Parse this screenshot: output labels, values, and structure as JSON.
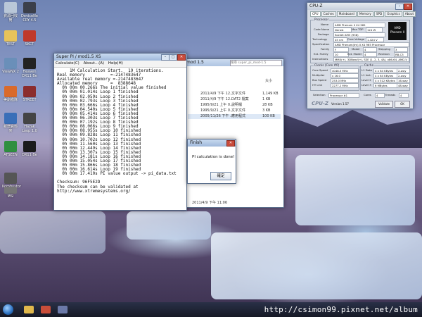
{
  "desktop_icons": [
    {
      "label": "資源回收筒"
    },
    {
      "label": "DeviceNe CRY 4.5"
    },
    {
      "label": "TEST"
    },
    {
      "label": "SKCT"
    },
    {
      "label": "ViewNX 2"
    },
    {
      "label": "Heaven DX11 Be"
    },
    {
      "label": "美劇艦隊"
    },
    {
      "label": "STREET"
    },
    {
      "label": "新增資料夾"
    },
    {
      "label": "Hazak Loop 1.0"
    },
    {
      "label": "AFSEEN"
    },
    {
      "label": "DX11 Be"
    },
    {
      "label": "Kombustor"
    },
    {
      "label": "MSI"
    }
  ],
  "superpi": {
    "title": "Super PI / mod1.5 XS",
    "menu": [
      "Calculate(C)",
      "About...(A)",
      "Help(H)"
    ],
    "log": [
      "     1M Calculation Start.  19 iterations.",
      "Real memory          =-2147483647",
      "Available real memory =-2147483647",
      "Allocated memory     =  8388648",
      "  0h 00m 00.266s The initial value finished",
      "  0h 00m 01.014s Loop 1 finished",
      "  0h 00m 02.059s Loop 2 finished",
      "  0h 00m 02.793s Loop 3 finished",
      "  0h 00m 03.666s Loop 4 finished",
      "  0h 00m 04.540s Loop 5 finished",
      "  0h 00m 05.414s Loop 6 finished",
      "  0h 00m 06.303s Loop 7 finished",
      "  0h 00m 07.192s Loop 8 finished",
      "  0h 00m 08.066s Loop 9 finished",
      "  0h 00m 08.955s Loop 10 finished",
      "  0h 00m 09.828s Loop 11 finished",
      "  0h 00m 10.702s Loop 12 finished",
      "  0h 00m 11.560s Loop 13 finished",
      "  0h 00m 12.449s Loop 14 finished",
      "  0h 00m 13.307s Loop 15 finished",
      "  0h 00m 14.181s Loop 16 finished",
      "  0h 00m 15.054s Loop 17 finished",
      "  0h 00m 15.866s Loop 18 finished",
      "  0h 00m 16.614s Loop 19 finished",
      "  0h 00m 17.410s PI value output -> pi_data.txt",
      "",
      "Checksum: 96F5E2D",
      "The checksum can be validated at",
      "http://www.xtremesystems.org/"
    ]
  },
  "explorer": {
    "path_label": "mod 1.5",
    "search_placeholder": "搜尋 super_pi_mod-1.5",
    "header_size": "大小",
    "rows": [
      {
        "date": "2011/4/9 下午 12...",
        "type": "文字文件",
        "size": "1,149 KB"
      },
      {
        "date": "2011/4/9 下午 12...",
        "type": "DAT2 檔案",
        "size": "1 KB"
      },
      {
        "date": "1995/9/21 上午 0...",
        "type": "說明檔",
        "size": "28 KB"
      },
      {
        "date": "1995/9/21 上午 0...",
        "type": "文字文件",
        "size": "3 KB"
      },
      {
        "date": "2005/11/26 下午 ...",
        "type": "應用程式",
        "size": "100 KB"
      }
    ],
    "status": "2011/4/9 下午 11:06"
  },
  "finish": {
    "title": "Finish",
    "message": "PI calculation is done!",
    "ok_label": "確定"
  },
  "cpuz": {
    "title": "CPU-Z",
    "tabs": [
      "CPU",
      "Caches",
      "Mainboard",
      "Memory",
      "SPD",
      "Graphics",
      "About"
    ],
    "processor_group": "Processor",
    "name_label": "Name",
    "name": "AMD Phenom II X4 965",
    "codename_label": "Code Name",
    "codename": "Deneb",
    "maxtdp_label": "Max TDP",
    "maxtdp": "124 W",
    "package_label": "Package",
    "package": "Socket AM3 (938)",
    "tech_label": "Technology",
    "tech": "45 nm",
    "voltage_label": "Core Voltage",
    "voltage": "1.424 V",
    "spec_label": "Specification",
    "spec": "AMD Phenom(tm) II X4 965 Processor",
    "family_label": "Family",
    "family": "F",
    "model_label": "Model",
    "model": "4",
    "stepping_label": "Stepping",
    "stepping": "3",
    "extfam_label": "Ext. Family",
    "extfam": "10",
    "extmodel_label": "Ext. Model",
    "extmodel": "4",
    "revision_label": "Revision",
    "revision": "RB-C3",
    "instr_label": "Instructions",
    "instr": "MMX(+), 3DNow!(+), SSE (1, 2, 3, 4A), x86-64, AMD-V",
    "clocks_group": "Clocks (Core #0)",
    "cache_group": "Cache",
    "corespeed_label": "Core Speed",
    "corespeed": "4048.5 MHz",
    "mult_label": "Multiplier",
    "mult": "x 16.0",
    "bus_label": "Bus Speed",
    "bus": "253.0 MHz",
    "ht_label": "HT Link",
    "ht": "2277.2 MHz",
    "l1d_label": "L1 Data",
    "l1d": "4 x 64 KBytes",
    "l1d_way": "2-way",
    "l1i_label": "L1 Inst.",
    "l1i": "4 x 64 KBytes",
    "l1i_way": "2-way",
    "l2_label": "Level 2",
    "l2": "4 x 512 KBytes",
    "l2_way": "16-way",
    "l3_label": "Level 3",
    "l3": "6 MBytes",
    "l3_way": "48-way",
    "selection_label": "Selection",
    "selection": "Processor #1",
    "cores_label": "Cores",
    "cores": "4",
    "threads_label": "Threads",
    "threads": "4",
    "version": "Version 1.57",
    "validate_label": "Validate",
    "ok_label": "OK",
    "brand": "AMD Phenom II"
  },
  "watermark": "http://csimon99.pixnet.net/album"
}
